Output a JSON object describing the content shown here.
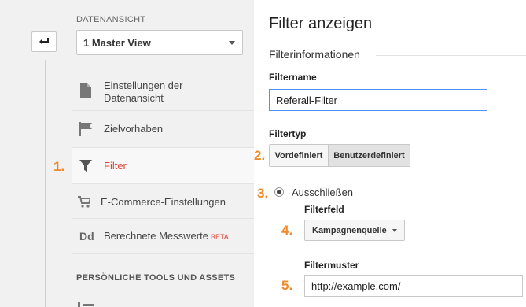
{
  "sidebar": {
    "section_view_label": "DATENANSICHT",
    "view_select_value": "1 Master View",
    "items": [
      {
        "label_line1": "Einstellungen der",
        "label_line2": "Datenansicht"
      },
      {
        "label": "Zielvorhaben"
      },
      {
        "label": "Filter"
      },
      {
        "label": "E-Commerce-Einstellungen"
      },
      {
        "label": "Berechnete Messwerte",
        "badge": "BETA"
      }
    ],
    "section_tools_label": "PERSÖNLICHE TOOLS UND ASSETS",
    "active_color": "#dd4433"
  },
  "steps": [
    "1.",
    "2.",
    "3.",
    "4.",
    "5."
  ],
  "main": {
    "title": "Filter anzeigen",
    "section_title": "Filterinformationen",
    "filter_name_label": "Filtername",
    "filter_name_value": "Referall-Filter",
    "filter_type_label": "Filtertyp",
    "filter_type_options": [
      "Vordefiniert",
      "Benutzerdefiniert"
    ],
    "exclude_label": "Ausschließen",
    "filter_field_label": "Filterfeld",
    "filter_field_value": "Kampagnenquelle",
    "filter_pattern_label": "Filtermuster",
    "filter_pattern_value": "http://example.com/"
  },
  "colors": {
    "step_orange": "#f0892a",
    "input_focus": "#4d90fe"
  }
}
